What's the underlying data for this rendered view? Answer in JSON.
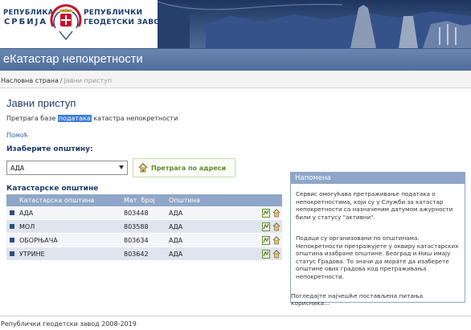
{
  "header": {
    "brand_left_line1": "РЕПУБЛИКА",
    "brand_left_line2": "СРБИЈА",
    "brand_right_line1": "РЕПУБЛИЧКИ",
    "brand_right_line2": "ГЕОДЕТСКИ ЗАВОД",
    "app_title": "еКатастар непокретности"
  },
  "breadcrumb": {
    "home": "Насловна страна",
    "separator": "/",
    "current": "Јавни приступ"
  },
  "main": {
    "title": "Јавни приступ",
    "subtitle_before": "Претрага базе ",
    "subtitle_highlight": "података",
    "subtitle_after": " катастра непокретности",
    "help_link": "Помоћ",
    "municipality_label": "Изаберите општину:",
    "municipality_selected": "АДА",
    "address_search_button": "Претрага по адреси",
    "cadastral_label": "Катастарске општине"
  },
  "table": {
    "columns": [
      "Катастарска општина",
      "Мат. број",
      "Општина"
    ],
    "rows": [
      {
        "name": "АДА",
        "number": "803448",
        "municipality": "АДА"
      },
      {
        "name": "МОЛ",
        "number": "803588",
        "municipality": "АДА"
      },
      {
        "name": "ОБОРЊАЧА",
        "number": "803634",
        "municipality": "АДА"
      },
      {
        "name": "УТРИНЕ",
        "number": "803642",
        "municipality": "АДА"
      }
    ]
  },
  "note": {
    "title": "Напомена",
    "paragraph1": "Сервис омогућава претраживање података о непокретностима, који су у Служби за катастар непокретности са назначеним датумом ажурности били у статусу \"активни\".",
    "paragraph2": "Подаци су организовани по општинама. Непокретности претражујете у оквиру катастарских општина изабране општине. Београд и Ниш имају статус Градова. То значи да морате да изаберете општине ових градова код претраживања непокретности.",
    "faq_link": "Погледајте најчешће постављена питања корисника..."
  },
  "footer": {
    "copyright": "Републички геодетски завод 2008-2019"
  },
  "colors": {
    "title_bar": "#5a78a6",
    "heading_text": "#1e3b6a",
    "table_header": "#8fa6c8",
    "address_button_text": "#5d8a2e"
  },
  "icons": {
    "emblem": "serbia-coat-of-arms-icon",
    "address": "house-icon",
    "row_action_1": "parcel-map-icon",
    "row_action_2": "house-icon"
  }
}
